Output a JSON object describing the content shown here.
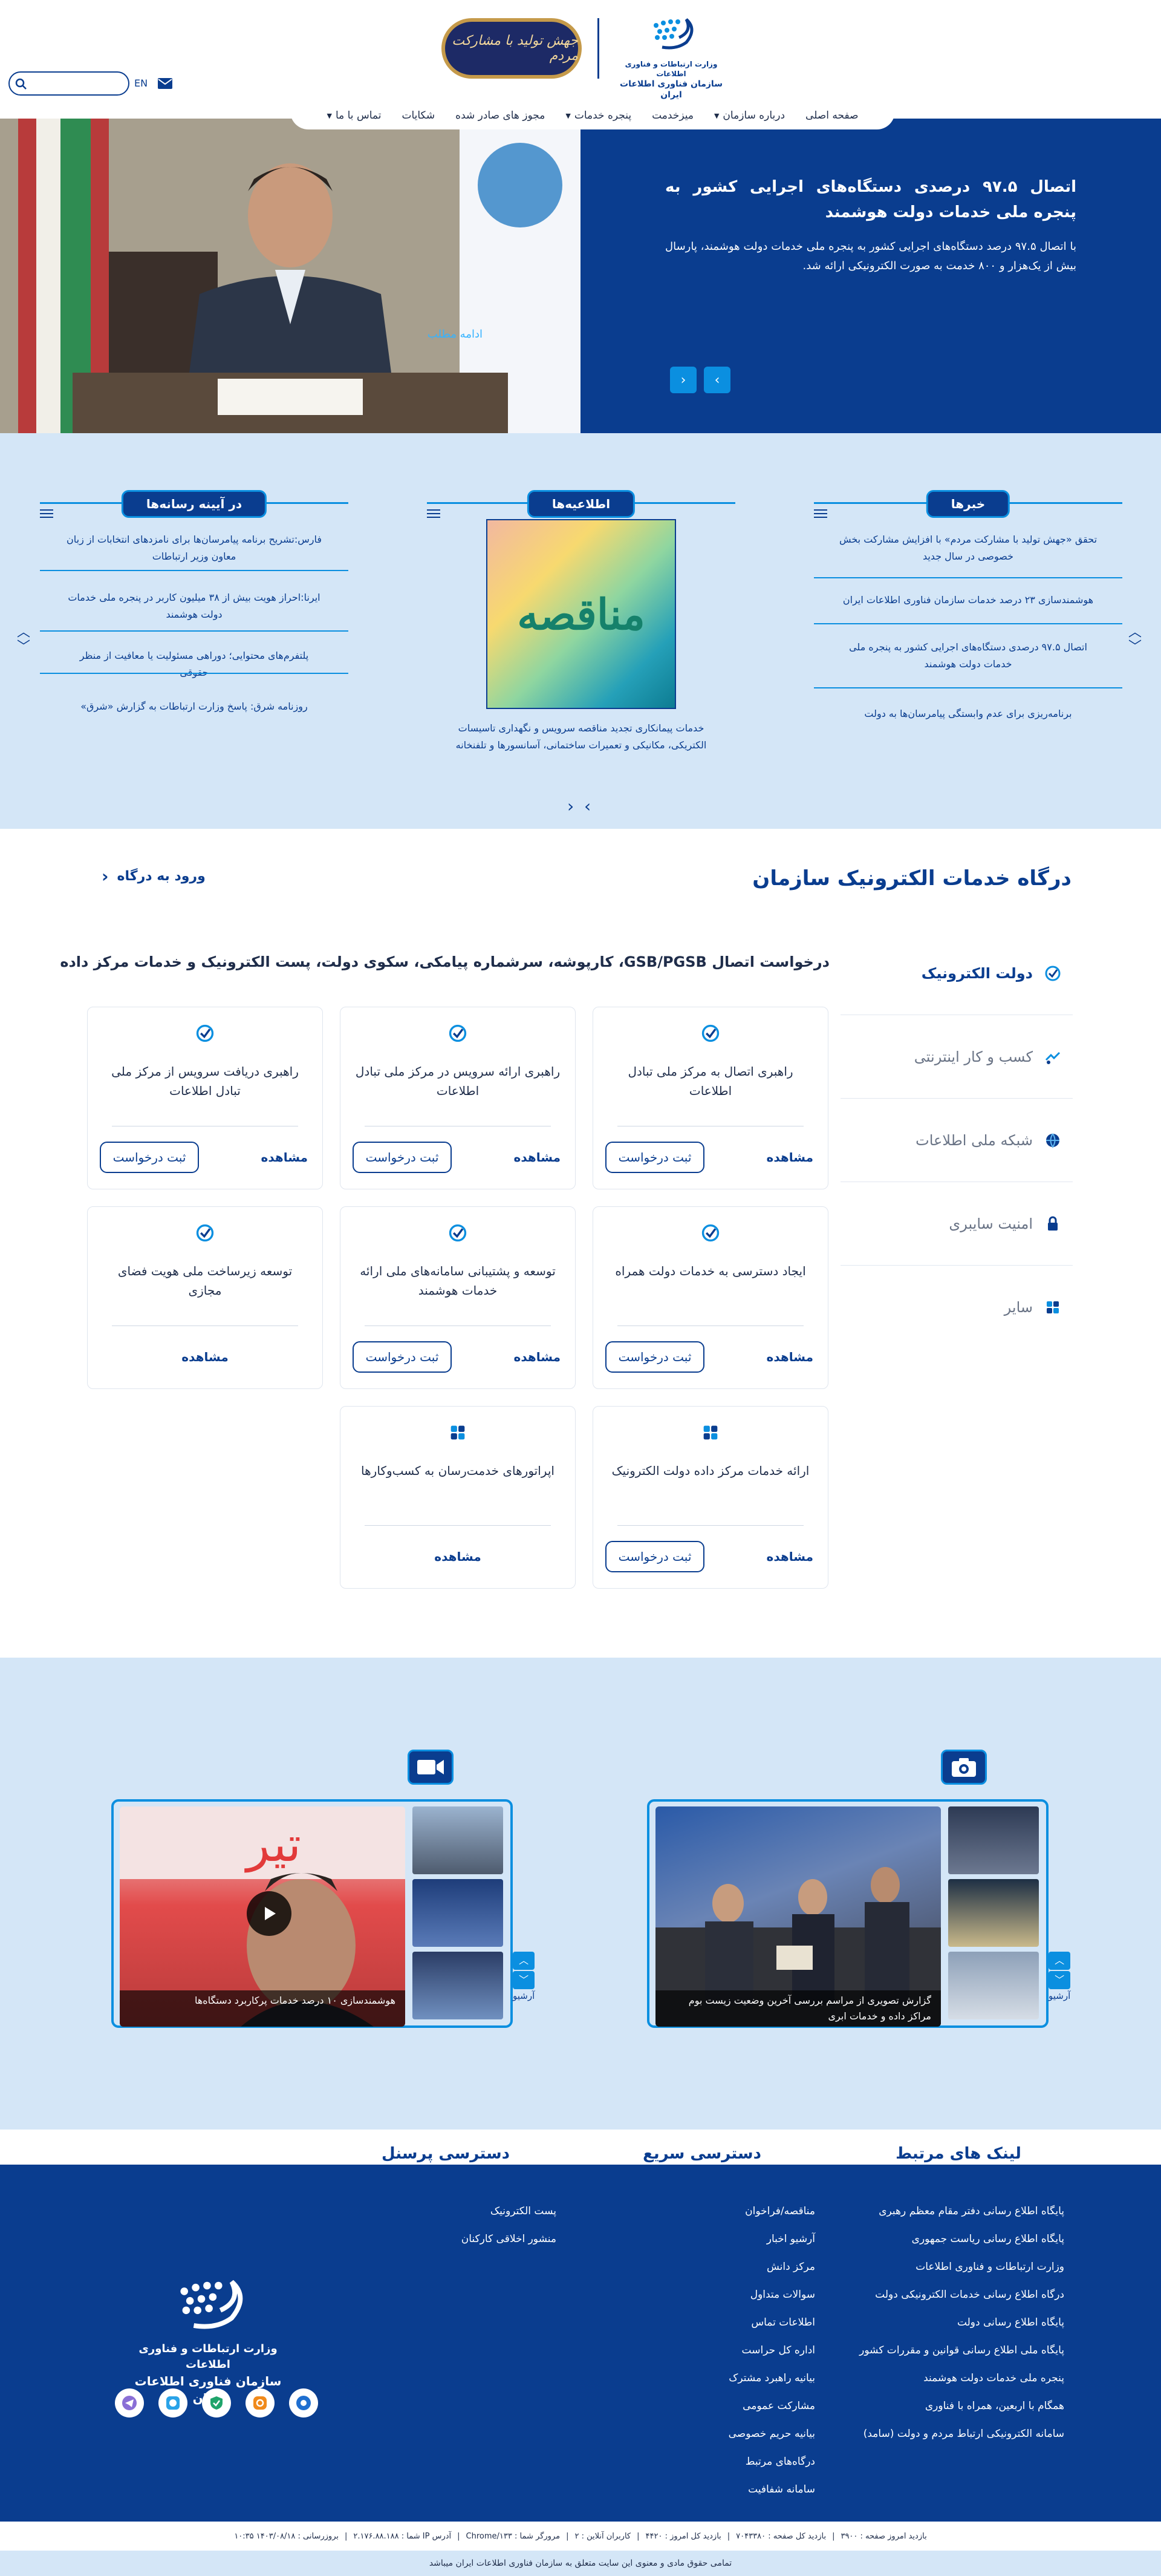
{
  "header": {
    "org_subtitle": "وزارت ارتباطات و فناوری اطلاعات",
    "org_name": "سازمان فناوری اطلاعات ایران",
    "slogan": "جهش تولید با مشارکت مردم",
    "lang": "EN",
    "search_placeholder": ""
  },
  "nav": {
    "items": [
      {
        "label": "صفحه اصلی",
        "dropdown": false
      },
      {
        "label": "درباره سازمان",
        "dropdown": true
      },
      {
        "label": "میزخدمت",
        "dropdown": false
      },
      {
        "label": "پنجره خدمات",
        "dropdown": true
      },
      {
        "label": "مجوز های صادر شده",
        "dropdown": false
      },
      {
        "label": "شکایات",
        "dropdown": false
      },
      {
        "label": "تماس با ما",
        "dropdown": true
      }
    ]
  },
  "hero": {
    "title": "اتصال ۹۷.۵ درصدی دستگاه‌های اجرایی کشور به پنجره ملی خدمات دولت هوشمند",
    "text": "با اتصال ۹۷.۵ درصد دستگاه‌های اجرایی کشور به پنجره ملی خدمات دولت هوشمند، پارسال بیش از یک‌هزار و ۸۰۰ خدمت به صورت الکترونیکی ارائه شد.",
    "more": "ادامه مطلب",
    "prev": "‹",
    "next": "›"
  },
  "news": {
    "title": "خبرها",
    "items": [
      "تحقق «جهش تولید با مشارکت مردم» با افزایش مشارکت بخش خصوصی در سال جدید",
      "هوشمندسازی ۲۳ درصد خدمات سازمان فناوری اطلاعات ایران",
      "اتصال ۹۷.۵ درصدی دستگاه‌های اجرایی کشور به پنجره ملی خدمات دولت هوشمند",
      "برنامه‌ریزی برای عدم وابستگی پیامرسان‌ها به دولت"
    ]
  },
  "announcements": {
    "title": "اطلاعیه‌ها",
    "image_text": "مناقصه",
    "caption": "خدمات پیمانکاری تجدید مناقصه سرویس و نگهداری تاسیسات الکتریکی، مکانیکی و تعمیرات ساختمانی، آسانسورها و تلفنخانه"
  },
  "press": {
    "title": "در آیینه رسانه‌ها",
    "items": [
      "فارس:تشریح برنامه پیامرسان‌ها برای نامزدهای انتخابات از زبان معاون وزیر ارتباطات",
      "ایرنا:احراز هویت بیش از ۳۸ میلیون کاربر در پنجره ملی خدمات دولت هوشمند",
      "پلتفرم‌های محتوایی؛ دوراهی مسئولیت یا معافیت از منظر حقوقی",
      "روزنامه شرق: پاسخ وزارت ارتباطات به گزارش «شرق»"
    ]
  },
  "services": {
    "title": "درگاه خدمات الکترونیک سازمان",
    "portal_link": "ورود به درگاه",
    "headline": "درخواست اتصال GSB/PGSB، کارپوشه، سرشماره پیامکی، سکوی دولت، پست الکترونیک و خدمات مرکز داده",
    "tabs": [
      {
        "label": "دولت الکترونیک",
        "active": true
      },
      {
        "label": "کسب و کار اینترنتی",
        "active": false
      },
      {
        "label": "شبکه ملی اطلاعات",
        "active": false
      },
      {
        "label": "امنیت سایبری",
        "active": false
      },
      {
        "label": "سایر",
        "active": false
      }
    ],
    "view_label": "مشاهده",
    "request_label": "ثبت درخواست",
    "cards": [
      {
        "title": "راهبری اتصال به مرکز ملی تبادل اطلاعات",
        "request": true
      },
      {
        "title": "راهبری ارائه سرویس در مرکز ملی تبادل اطلاعات",
        "request": true
      },
      {
        "title": "راهبری دریافت سرویس از مرکز ملی تبادل اطلاعات",
        "request": true
      },
      {
        "title": "ایجاد دسترسی به خدمات دولت همراه",
        "request": true
      },
      {
        "title": "توسعه و پشتیبانی سامانه‌های ملی ارائه خدمات هوشمند",
        "request": true
      },
      {
        "title": "توسعه زیرساخت ملی هویت فضای مجازی",
        "request": false
      },
      {
        "title": "ارائه خدمات مرکز داده دولت الکترونیک",
        "request": true
      },
      {
        "title": "اپراتورهای خدمت‌رسان به کسب‌وکارها",
        "request": false
      }
    ]
  },
  "media": {
    "photo_caption": "گزارش تصویری از مراسم بررسی آخرین وضعیت زیست بوم مراکز داده و خدمات ابری",
    "video_caption": "هوشمندسازی ۱۰ درصد خدمات پرکاربرد دستگاه‌ها",
    "archive": "آرشیو"
  },
  "footer": {
    "tabs": [
      "لینک های مرتبط",
      "دسترسی سریع",
      "دسترسی پرسنل"
    ],
    "related_links": [
      "پایگاه اطلاع رسانی دفتر مقام معظم رهبری",
      "پایگاه اطلاع رسانی ریاست جمهوری",
      "وزارت ارتباطات و فناوری اطلاعات",
      "درگاه اطلاع رسانی خدمات الکترونیکی دولت",
      "پایگاه اطلاع رسانی دولت",
      "پایگاه ملی اطلاع رسانی قوانین و مقررات کشور",
      "پنجره ملی خدمات دولت هوشمند",
      "همگام با اربعین، همراه با فناوری",
      "سامانه الکترونیکی ارتباط مردم و دولت (سامد)"
    ],
    "quick_access": [
      "مناقصه/فراخوان",
      "آرشیو اخبار",
      "مرکز دانش",
      "سوالات متداول",
      "اطلاعات تماس",
      "اداره کل حراست",
      "بیانیه راهبرد مشترک",
      "مشارکت عمومی",
      "بیانیه حریم خصوصی",
      "درگاه‌های مرتبط",
      "سامانه شفافیت"
    ],
    "personnel": [
      "پست الکترونیک",
      "منشور اخلاقی کارکنان"
    ],
    "org_subtitle": "وزارت ارتباطات و فناوری اطلاعات",
    "org_name": "سازمان فناوری اطلاعات ایران"
  },
  "stats": {
    "today": "بازدید امروز صفحه : ۳۹۰۰",
    "total_page": "بازدید کل صفحه : ۷۰۴۳۳۸۰",
    "total_today": "بازدید کل امروز : ۴۴۲۰",
    "online": "کاربران آنلاین : ۲",
    "browser": "مرورگر شما : Chrome/۱۳۳",
    "ip": "آدرس IP شما : ۲.۱۷۶.۸۸.۱۸۸",
    "updated": "بروزرسانی : ۱۴۰۳/۰۸/۱۸ ۱۰:۳۵"
  },
  "copyright": "تمامی حقوق مادی و معنوی این سایت متعلق به سازمان فناوری اطلاعات ایران میباشد",
  "colors": {
    "primary": "#0a3d8f",
    "accent": "#0b8fe0",
    "light_bg": "#d4e6f7"
  }
}
